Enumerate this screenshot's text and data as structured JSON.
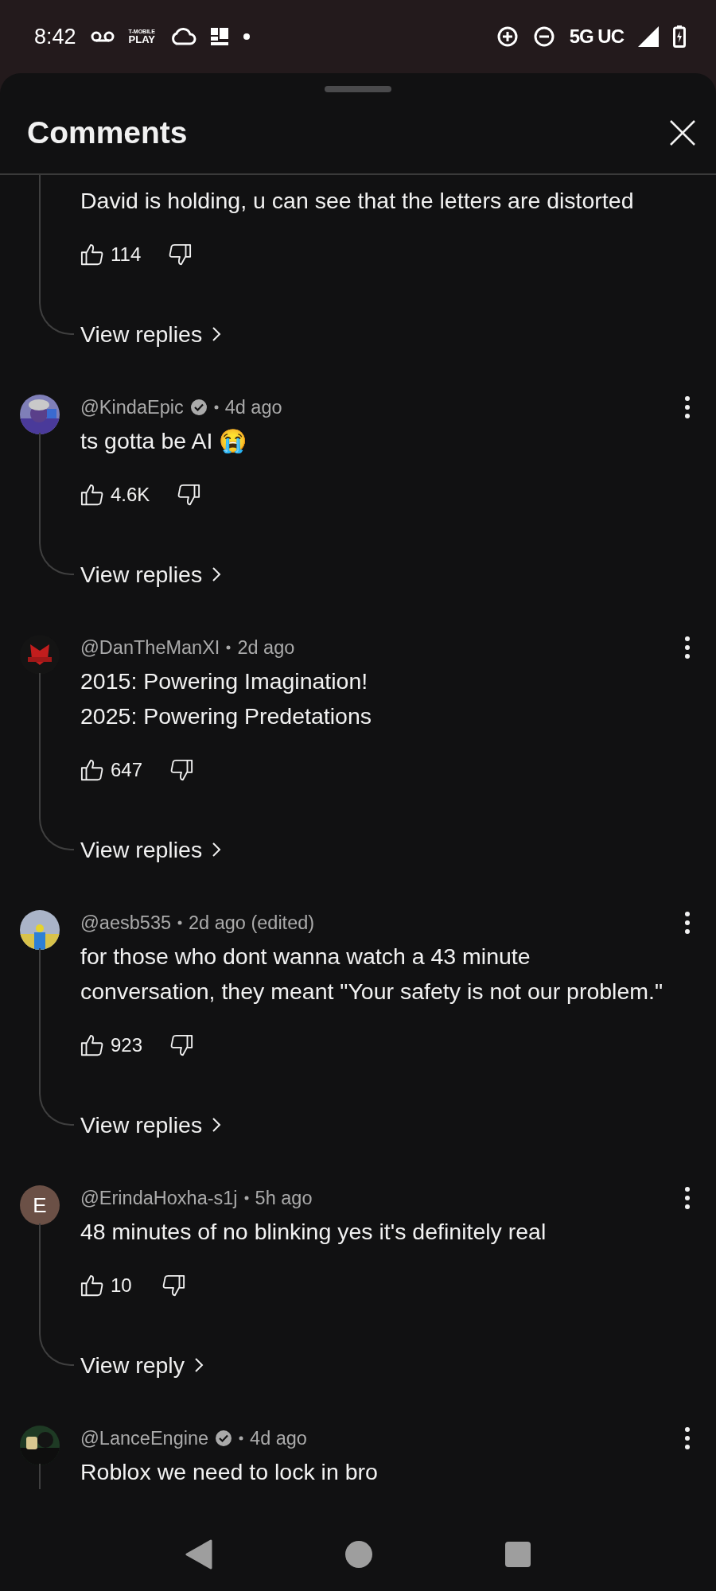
{
  "status_bar": {
    "time": "8:42",
    "carrier_top": "T-MOBILE",
    "carrier_bottom": "PLAY",
    "network": "5G UC"
  },
  "sheet": {
    "title": "Comments"
  },
  "comments": [
    {
      "kind": "partial",
      "body": "David is holding, u can see that the letters are distorted",
      "likes": "114",
      "replies": "View replies"
    },
    {
      "kind": "full",
      "author": "@KindaEpic",
      "verified": true,
      "time": "4d ago",
      "body": "ts gotta be AI 😭",
      "likes": "4.6K",
      "replies": "View replies"
    },
    {
      "kind": "full",
      "author": "@DanTheManXI",
      "verified": false,
      "time": "2d ago",
      "body": "2015: Powering Imagination!\n2025: Powering Predetations",
      "likes": "647",
      "replies": "View replies"
    },
    {
      "kind": "full",
      "author": "@aesb535",
      "verified": false,
      "time": "2d ago (edited)",
      "body": "for those who dont wanna watch a 43 minute conversation, they meant \"Your safety is not our problem.\"",
      "likes": "923",
      "replies": "View replies"
    },
    {
      "kind": "full",
      "avatar": {
        "kind": "letter",
        "letter": "E",
        "color": "#6b5046"
      },
      "author": "@ErindaHoxha-s1j",
      "verified": false,
      "time": "5h ago",
      "body": "48 minutes of no blinking yes it's definitely real",
      "likes": "10",
      "replies": "View reply"
    },
    {
      "kind": "full",
      "author": "@LanceEngine",
      "verified": true,
      "time": "4d ago",
      "body": "Roblox we need to lock in bro"
    }
  ]
}
